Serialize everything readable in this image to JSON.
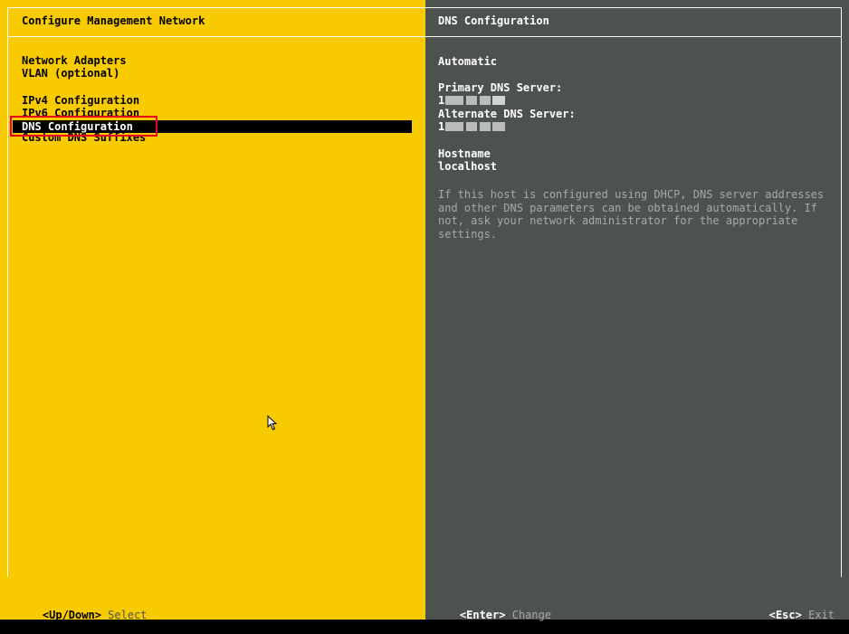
{
  "left_panel": {
    "title": "Configure Management Network",
    "menu_items": [
      {
        "label": "Network Adapters"
      },
      {
        "label": "VLAN (optional)"
      },
      {
        "label": "IPv4 Configuration"
      },
      {
        "label": "IPv6 Configuration"
      },
      {
        "label": "DNS Configuration",
        "selected": true
      },
      {
        "label": "Custom DNS Suffixes"
      }
    ],
    "footer": {
      "key": "<Up/Down>",
      "hint": "Select"
    }
  },
  "right_panel": {
    "title": "DNS Configuration",
    "mode": "Automatic",
    "primary_dns_label": "Primary DNS Server:",
    "primary_dns_value": "1",
    "alternate_dns_label": "Alternate DNS Server:",
    "alternate_dns_value": "1",
    "hostname_label": "Hostname",
    "hostname_value": "localhost",
    "help_text": "If this host is configured using DHCP, DNS server addresses\nand other DNS parameters can be obtained automatically. If\nnot, ask your network administrator for the appropriate\nsettings.",
    "footer_enter": {
      "key": "<Enter>",
      "hint": "Change"
    },
    "footer_esc": {
      "key": "<Esc>",
      "hint": "Exit"
    }
  },
  "colors": {
    "left_background": "#f8ca00",
    "right_background": "#4d524f",
    "selection_highlight": "#000000",
    "annotation_box": "#e8001c"
  },
  "icons": [
    "mouse-pointer-icon"
  ]
}
